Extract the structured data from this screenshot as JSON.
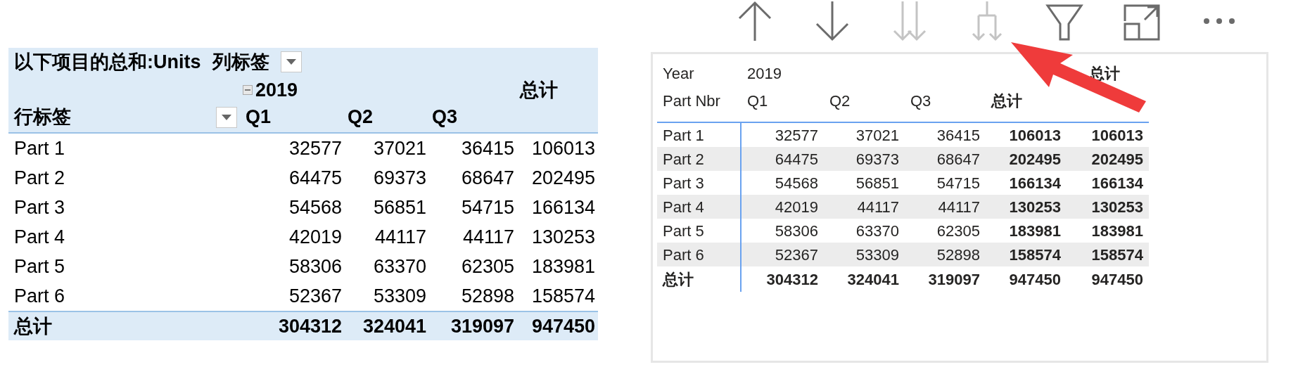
{
  "excel_pivot": {
    "value_label": "以下项目的总和:Units",
    "column_label": "列标签",
    "year": "2019",
    "grand_total_header": "总计",
    "row_label": "行标签",
    "quarters": [
      "Q1",
      "Q2",
      "Q3"
    ],
    "rows": [
      {
        "label": "Part 1",
        "values": [
          "32577",
          "37021",
          "36415",
          "106013"
        ]
      },
      {
        "label": "Part 2",
        "values": [
          "64475",
          "69373",
          "68647",
          "202495"
        ]
      },
      {
        "label": "Part 3",
        "values": [
          "54568",
          "56851",
          "54715",
          "166134"
        ]
      },
      {
        "label": "Part 4",
        "values": [
          "42019",
          "44117",
          "44117",
          "130253"
        ]
      },
      {
        "label": "Part 5",
        "values": [
          "58306",
          "63370",
          "62305",
          "183981"
        ]
      },
      {
        "label": "Part 6",
        "values": [
          "52367",
          "53309",
          "52898",
          "158574"
        ]
      }
    ],
    "total": {
      "label": "总计",
      "values": [
        "304312",
        "324041",
        "319097",
        "947450"
      ]
    }
  },
  "toolbar": [
    {
      "kind": "up",
      "disabled": false
    },
    {
      "kind": "down",
      "disabled": false
    },
    {
      "kind": "expand",
      "disabled": true
    },
    {
      "kind": "fork",
      "disabled": true
    },
    {
      "kind": "filter",
      "disabled": false
    },
    {
      "kind": "focus",
      "disabled": false
    },
    {
      "kind": "more",
      "disabled": false
    }
  ],
  "matrix": {
    "year_label": "Year",
    "year": "2019",
    "top_total_header": "总计",
    "field_label": "Part Nbr",
    "columns": [
      "Q1",
      "Q2",
      "Q3",
      "总计"
    ],
    "rows": [
      {
        "label": "Part 1",
        "values": [
          "32577",
          "37021",
          "36415",
          "106013",
          "106013"
        ]
      },
      {
        "label": "Part 2",
        "values": [
          "64475",
          "69373",
          "68647",
          "202495",
          "202495"
        ]
      },
      {
        "label": "Part 3",
        "values": [
          "54568",
          "56851",
          "54715",
          "166134",
          "166134"
        ]
      },
      {
        "label": "Part 4",
        "values": [
          "42019",
          "44117",
          "44117",
          "130253",
          "130253"
        ]
      },
      {
        "label": "Part 5",
        "values": [
          "58306",
          "63370",
          "62305",
          "183981",
          "183981"
        ]
      },
      {
        "label": "Part 6",
        "values": [
          "52367",
          "53309",
          "52898",
          "158574",
          "158574"
        ]
      }
    ],
    "total": {
      "label": "总计",
      "values": [
        "304312",
        "324041",
        "319097",
        "947450",
        "947450"
      ]
    }
  }
}
